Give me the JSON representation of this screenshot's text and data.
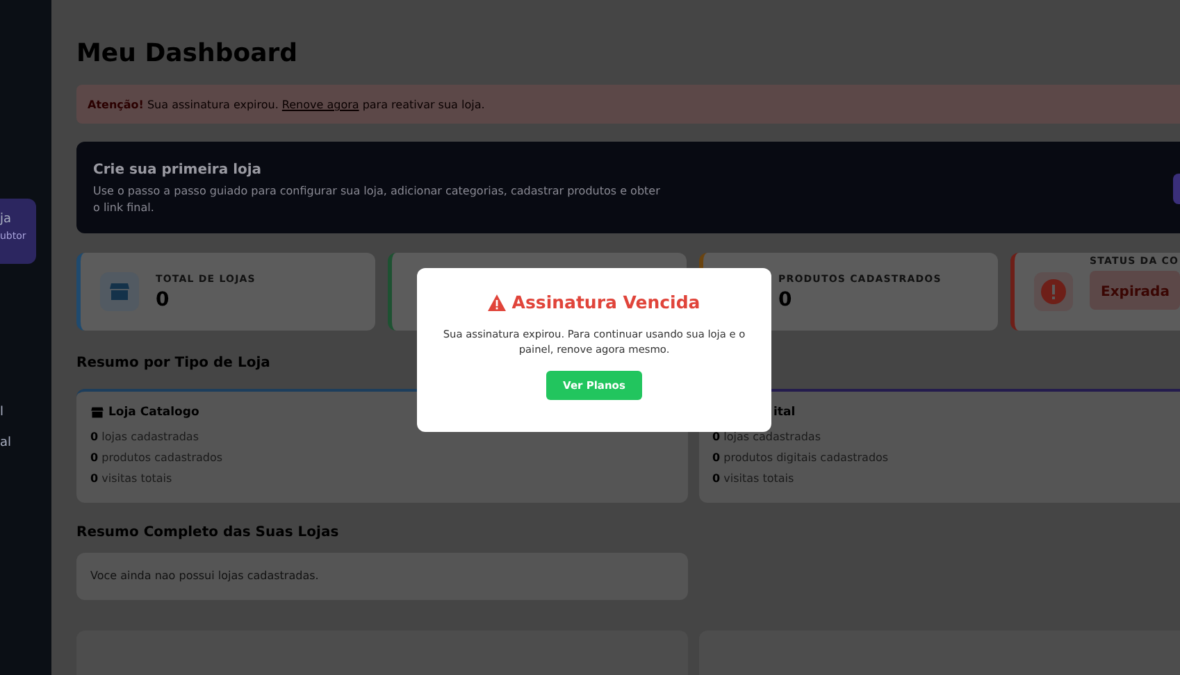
{
  "sidebar": {
    "items": [
      {
        "label": "ja",
        "sublabel": "ubtor",
        "selected": true
      },
      {
        "label": "l",
        "selected": false
      },
      {
        "label": "al",
        "selected": false
      }
    ]
  },
  "page_title": "Meu Dashboard",
  "alert": {
    "lead": "Atenção!",
    "text_before": "Sua assinatura expirou.",
    "link": "Renove agora",
    "text_after": "para reativar sua loja."
  },
  "onboarding": {
    "title": "Crie sua primeira loja",
    "description": "Use o passo a passo guiado para configurar sua loja, adicionar categorias, cadastrar produtos e obter o link final."
  },
  "stats": [
    {
      "kind": "store",
      "label": "TOTAL DE LOJAS",
      "value": "0",
      "color": "#1f4a6e"
    },
    {
      "kind": "hidden",
      "color": "#1e5232"
    },
    {
      "kind": "hidden-icon",
      "label": "PRODUTOS CADASTRADOS",
      "value": "0",
      "color": "#6a4410"
    },
    {
      "kind": "alert",
      "label": "STATUS DA CO",
      "value": "Expirada",
      "color": "#6e1f18"
    }
  ],
  "type_section": {
    "title": "Resumo por Tipo de Loja",
    "cards": [
      {
        "title": "Loja Catalogo",
        "color": "#1d3e5c",
        "icon": true,
        "rows": [
          {
            "count": "0",
            "text": "lojas cadastradas"
          },
          {
            "count": "0",
            "text": "produtos cadastrados"
          },
          {
            "count": "0",
            "text": "visitas totais"
          }
        ]
      },
      {
        "title": "ital",
        "color": "#241c4d",
        "icon": false,
        "rows": [
          {
            "count": "0",
            "text": "lojas cadastradas"
          },
          {
            "count": "0",
            "text": "produtos digitais cadastrados"
          },
          {
            "count": "0",
            "text": "visitas totais"
          }
        ]
      }
    ]
  },
  "summary_section": {
    "title": "Resumo Completo das Suas Lojas",
    "empty_text": "Voce ainda nao possui lojas cadastradas."
  },
  "modal": {
    "title": "Assinatura Vencida",
    "message": "Sua assinatura expirou. Para continuar usando sua loja e o painel, renove agora mesmo.",
    "button": "Ver Planos"
  }
}
